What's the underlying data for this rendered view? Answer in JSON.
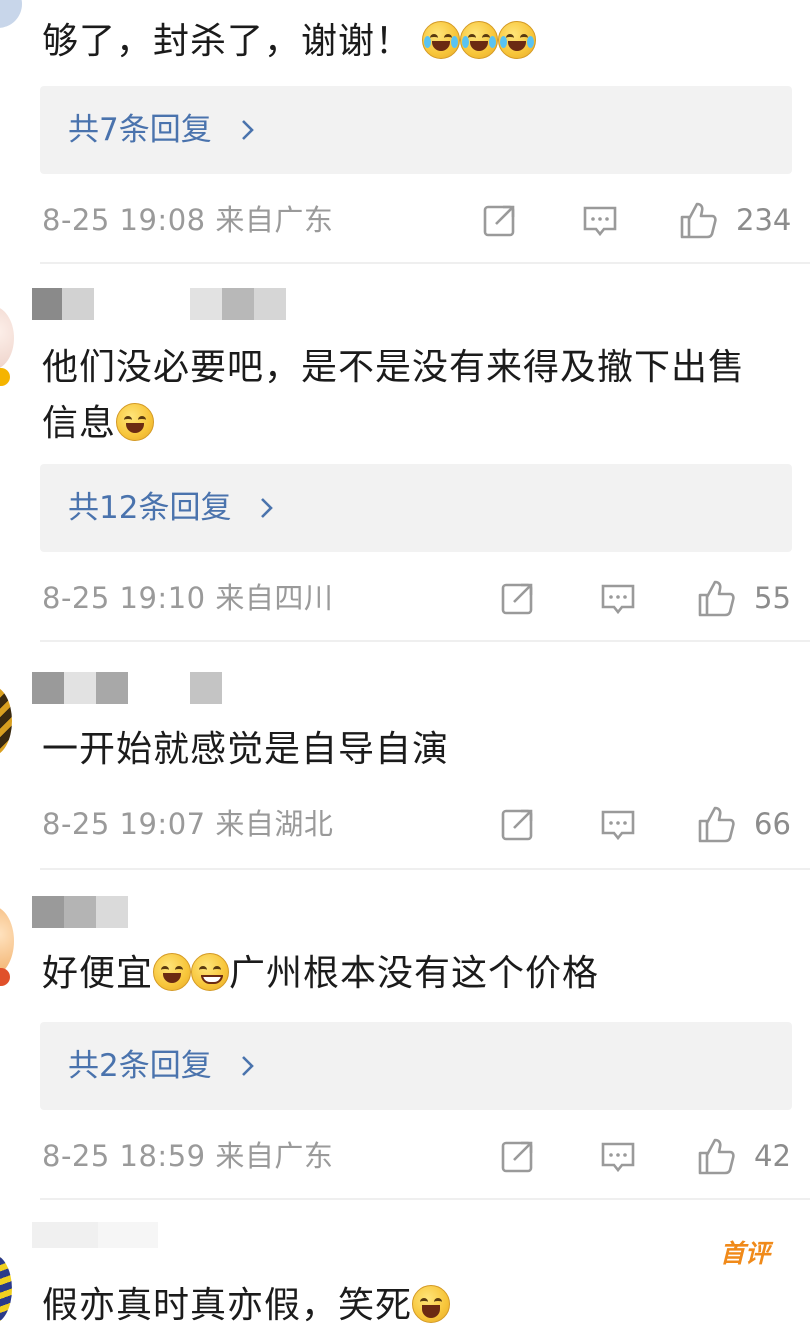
{
  "comments": [
    {
      "text": "够了，封杀了，谢谢！",
      "emojis": [
        "laugh-cry-emoji",
        "laugh-cry-emoji",
        "laugh-cry-emoji"
      ],
      "replies_label": "共7条回复",
      "time": "8-25 19:08",
      "location": "来自广东",
      "likes": "234"
    },
    {
      "text_line1": "他们没必要吧，是不是没有来得及撤下出售",
      "text_line2": "信息",
      "emojis": [
        "grin-emoji"
      ],
      "replies_label": "共12条回复",
      "time": "8-25 19:10",
      "location": "来自四川",
      "likes": "55"
    },
    {
      "text": "一开始就感觉是自导自演",
      "time": "8-25 19:07",
      "location": "来自湖北",
      "likes": "66"
    },
    {
      "text_a": "好便宜",
      "text_b": "广州根本没有这个价格",
      "emojis": [
        "grin-emoji",
        "awkward-smile-emoji"
      ],
      "replies_label": "共2条回复",
      "time": "8-25 18:59",
      "location": "来自广东",
      "likes": "42"
    },
    {
      "badge": "首评",
      "text": "假亦真时真亦假，笑死",
      "emojis": [
        "grin-emoji"
      ]
    }
  ],
  "icons": {
    "repost": "repost-icon",
    "comment": "comment-icon",
    "like": "thumbs-up-icon",
    "chevron": "chevron-right-icon"
  },
  "colors": {
    "link": "#4a73ad",
    "meta": "#9a9a9a",
    "badge": "#f08a1a",
    "reply_bg": "#f2f2f2"
  }
}
